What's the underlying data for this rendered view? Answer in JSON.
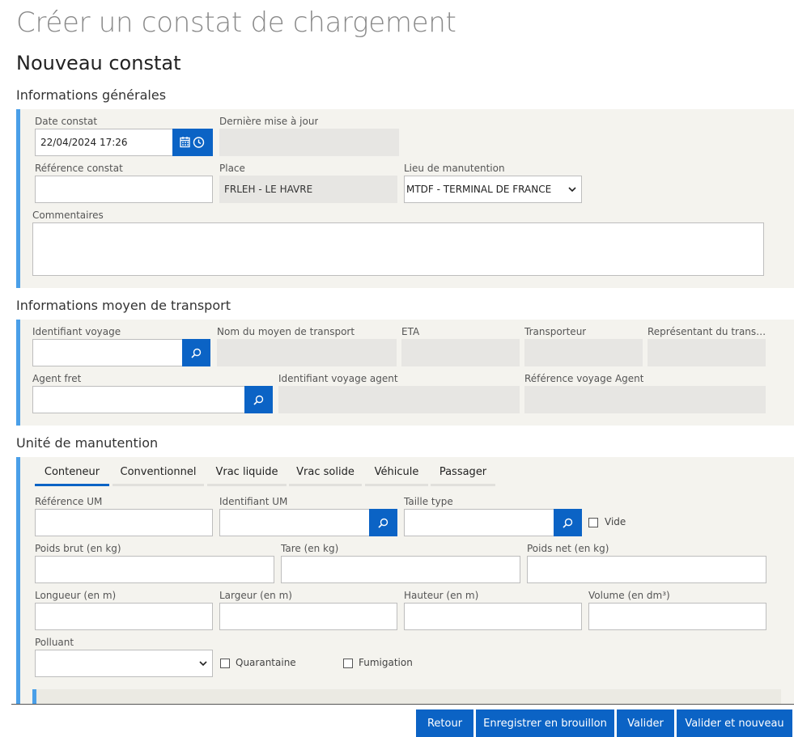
{
  "page": {
    "title": "Créer un constat de chargement",
    "subtitle": "Nouveau constat"
  },
  "general": {
    "section_title": "Informations générales",
    "date_label": "Date constat",
    "date_value": "22/04/2024 17:26",
    "last_update_label": "Dernière mise à jour",
    "last_update_value": "",
    "reference_label": "Référence constat",
    "reference_value": "",
    "place_label": "Place",
    "place_value": "FRLEH - LE HAVRE",
    "lieu_label": "Lieu de manutention",
    "lieu_value": "MTDF - TERMINAL DE FRANCE",
    "comments_label": "Commentaires",
    "comments_value": ""
  },
  "transport": {
    "section_title": "Informations moyen de transport",
    "voyage_label": "Identifiant voyage",
    "voyage_value": "",
    "vessel_name_label": "Nom du moyen de transport",
    "eta_label": "ETA",
    "carrier_label": "Transporteur",
    "representative_label": "Représentant du transp...",
    "agent_label": "Agent fret",
    "agent_value": "",
    "agent_voyage_label": "Identifiant voyage agent",
    "agent_ref_label": "Référence voyage Agent"
  },
  "unit": {
    "section_title": "Unité de manutention",
    "tabs": [
      {
        "label": "Conteneur",
        "active": true
      },
      {
        "label": "Conventionnel",
        "active": false
      },
      {
        "label": "Vrac liquide",
        "active": false
      },
      {
        "label": "Vrac solide",
        "active": false
      },
      {
        "label": "Véhicule",
        "active": false
      },
      {
        "label": "Passager",
        "active": false
      }
    ],
    "ref_um_label": "Référence UM",
    "id_um_label": "Identifiant UM",
    "size_type_label": "Taille type",
    "empty_label": "Vide",
    "gross_weight_label": "Poids brut (en kg)",
    "tare_label": "Tare (en kg)",
    "net_weight_label": "Poids net (en kg)",
    "length_label": "Longueur (en m)",
    "width_label": "Largeur (en m)",
    "height_label": "Hauteur (en m)",
    "volume_label": "Volume (en dm³)",
    "pollutant_label": "Polluant",
    "pollutant_value": "",
    "quarantine_label": "Quarantaine",
    "fumigation_label": "Fumigation"
  },
  "footer": {
    "back_label": "Retour",
    "draft_label": "Enregistrer en brouillon",
    "validate_label": "Valider",
    "validate_new_label": "Valider et nouveau"
  },
  "colors": {
    "accent": "#0b63c5",
    "panel_border": "#4a9fe8",
    "panel_bg": "#f4f3ee"
  },
  "icons": {
    "calendar": "calendar-icon",
    "clock": "clock-icon",
    "search": "search-icon",
    "chevron": "chevron-down-icon"
  }
}
